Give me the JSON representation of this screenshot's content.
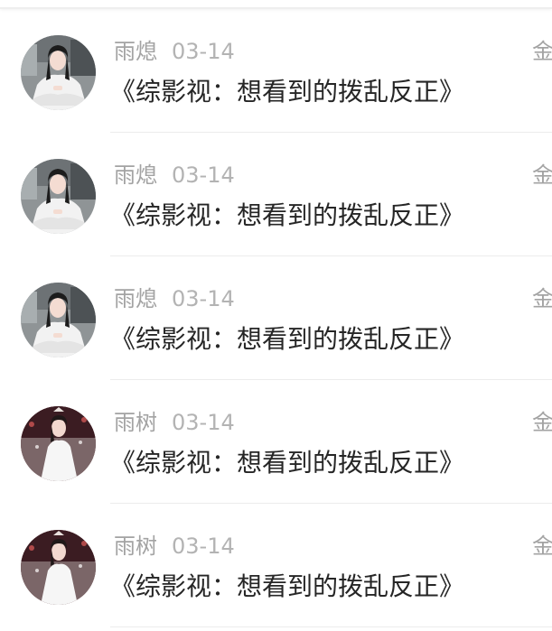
{
  "colors": {
    "name": "#a3a3a3",
    "date": "#b3b3b3",
    "title": "#262626",
    "divider": "#ececec"
  },
  "items": [
    {
      "author": "雨熄",
      "date": "03-14",
      "title": "《综影视：想看到的拨乱反正》",
      "side": "金",
      "avatar": "woman-gray-background-avatar"
    },
    {
      "author": "雨熄",
      "date": "03-14",
      "title": "《综影视：想看到的拨乱反正》",
      "side": "金",
      "avatar": "woman-gray-background-avatar"
    },
    {
      "author": "雨熄",
      "date": "03-14",
      "title": "《综影视：想看到的拨乱反正》",
      "side": "金",
      "avatar": "woman-gray-background-avatar"
    },
    {
      "author": "雨树",
      "date": "03-14",
      "title": "《综影视：想看到的拨乱反正》",
      "side": "金",
      "avatar": "woman-dark-red-background-avatar"
    },
    {
      "author": "雨树",
      "date": "03-14",
      "title": "《综影视：想看到的拨乱反正》",
      "side": "金",
      "avatar": "woman-dark-red-background-avatar"
    }
  ]
}
